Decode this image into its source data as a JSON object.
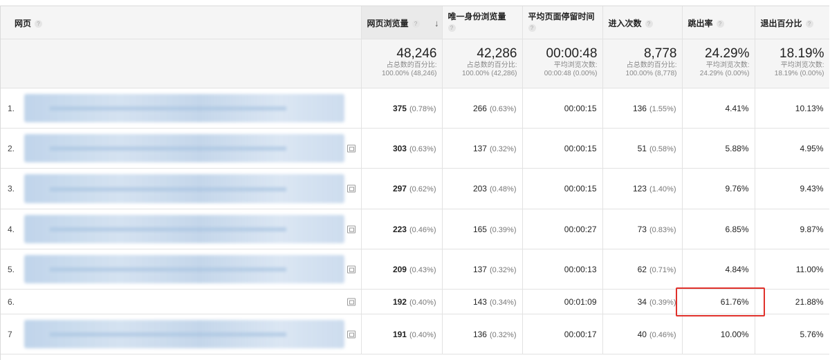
{
  "columns": {
    "page": "网页",
    "pageviews": "网页浏览量",
    "unique_pageviews": "唯一身份浏览量",
    "avg_time": "平均页面停留时间",
    "entrances": "进入次数",
    "bounce_rate": "跳出率",
    "exit_pct": "退出百分比",
    "help_glyph": "?",
    "sort_glyph": "↓"
  },
  "totals": {
    "pageviews": {
      "value": "48,246",
      "sub1": "占总数的百分比:",
      "sub2": "100.00% (48,246)"
    },
    "unique_pageviews": {
      "value": "42,286",
      "sub1": "占总数的百分比:",
      "sub2": "100.00% (42,286)"
    },
    "avg_time": {
      "value": "00:00:48",
      "sub1": "平均浏览次数:",
      "sub2": "00:00:48 (0.00%)"
    },
    "entrances": {
      "value": "8,778",
      "sub1": "占总数的百分比:",
      "sub2": "100.00% (8,778)"
    },
    "bounce_rate": {
      "value": "24.29%",
      "sub1": "平均浏览次数:",
      "sub2": "24.29% (0.00%)"
    },
    "exit_pct": {
      "value": "18.19%",
      "sub1": "平均浏览次数:",
      "sub2": "18.19% (0.00%)"
    }
  },
  "rows": [
    {
      "index": "1.",
      "pageviews": "375",
      "pageviews_pct": "(0.78%)",
      "unique": "266",
      "unique_pct": "(0.63%)",
      "avg_time": "00:00:15",
      "entrances": "136",
      "entrances_pct": "(1.55%)",
      "bounce": "4.41%",
      "exit": "10.13%"
    },
    {
      "index": "2.",
      "pageviews": "303",
      "pageviews_pct": "(0.63%)",
      "unique": "137",
      "unique_pct": "(0.32%)",
      "avg_time": "00:00:15",
      "entrances": "51",
      "entrances_pct": "(0.58%)",
      "bounce": "5.88%",
      "exit": "4.95%"
    },
    {
      "index": "3.",
      "pageviews": "297",
      "pageviews_pct": "(0.62%)",
      "unique": "203",
      "unique_pct": "(0.48%)",
      "avg_time": "00:00:15",
      "entrances": "123",
      "entrances_pct": "(1.40%)",
      "bounce": "9.76%",
      "exit": "9.43%"
    },
    {
      "index": "4.",
      "pageviews": "223",
      "pageviews_pct": "(0.46%)",
      "unique": "165",
      "unique_pct": "(0.39%)",
      "avg_time": "00:00:27",
      "entrances": "73",
      "entrances_pct": "(0.83%)",
      "bounce": "6.85%",
      "exit": "9.87%"
    },
    {
      "index": "5.",
      "pageviews": "209",
      "pageviews_pct": "(0.43%)",
      "unique": "137",
      "unique_pct": "(0.32%)",
      "avg_time": "00:00:13",
      "entrances": "62",
      "entrances_pct": "(0.71%)",
      "bounce": "4.84%",
      "exit": "11.00%"
    },
    {
      "index": "6.",
      "pageviews": "192",
      "pageviews_pct": "(0.40%)",
      "unique": "143",
      "unique_pct": "(0.34%)",
      "avg_time": "00:01:09",
      "entrances": "34",
      "entrances_pct": "(0.39%)",
      "bounce": "61.76%",
      "exit": "21.88%"
    },
    {
      "index": "7",
      "pageviews": "191",
      "pageviews_pct": "(0.40%)",
      "unique": "136",
      "unique_pct": "(0.32%)",
      "avg_time": "00:00:17",
      "entrances": "40",
      "entrances_pct": "(0.46%)",
      "bounce": "10.00%",
      "exit": "5.76%"
    }
  ],
  "colors": {
    "highlight": "#e0302a",
    "header_bg": "#f5f5f5",
    "help_bg": "#e5e5e5"
  },
  "icons": {
    "help": "question-circle-icon",
    "sort": "sort-desc-arrow-icon",
    "popout": "open-in-new-window-icon"
  }
}
